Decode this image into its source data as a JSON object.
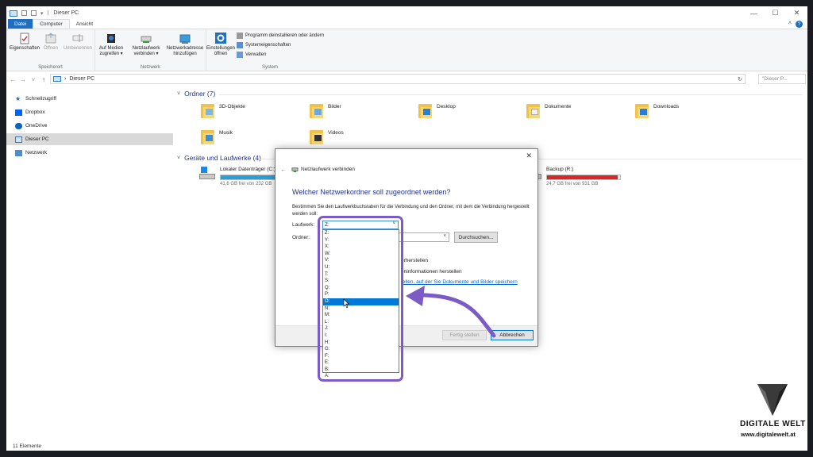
{
  "window": {
    "title": "Dieser PC",
    "controls": [
      "—",
      "☐",
      "✕"
    ]
  },
  "ribbon_tabs": [
    "Datei",
    "Computer",
    "Ansicht"
  ],
  "ribbon": {
    "groups": [
      {
        "label": "Speicherort",
        "buttons": [
          "Eigenschaften",
          "Öffnen",
          "Umbenennen"
        ]
      },
      {
        "label": "Netzwerk",
        "buttons": [
          "Auf Medien zugreifen ▾",
          "Netzlaufwerk verbinden ▾",
          "Netzwerkadresse hinzufügen"
        ]
      },
      {
        "label": "System",
        "buttons": [
          "Einstellungen öffnen"
        ],
        "small_buttons": [
          "Programm deinstallieren oder ändern",
          "Systemeigenschaften",
          "Verwalten"
        ]
      }
    ],
    "colors": {
      "file_tab": "#1e6fc2",
      "icon_blue": "#2f7bd0"
    }
  },
  "address": {
    "crumb": "Dieser PC",
    "search_placeholder": "\"Dieser P..."
  },
  "sidebar": {
    "items": [
      "Schnellzugriff",
      "Dropbox",
      "OneDrive",
      "Dieser PC",
      "Netzwerk"
    ],
    "selected": "Dieser PC"
  },
  "content": {
    "folders_header": "Ordner (7)",
    "folders": [
      "3D-Objekte",
      "Bilder",
      "Desktop",
      "Dokumente",
      "Downloads",
      "Musik",
      "Videos"
    ],
    "drives_header": "Geräte und Laufwerke (4)",
    "drives": [
      {
        "name": "Lokaler Datenträger (C:)",
        "free": "41,6 GB frei von 232 GB",
        "used_fraction": 0.82,
        "color": "#26a0da"
      },
      {
        "name": "Backup (R:)",
        "free": "24,7 GB frei von 931 GB",
        "used_fraction": 0.97,
        "color": "#da2626"
      }
    ]
  },
  "status_bar": {
    "items_count": "11 Elemente"
  },
  "dialog": {
    "title": "Netzlaufwerk verbinden",
    "heading": "Welcher Netzwerkordner soll zugeordnet werden?",
    "description": "Bestimmen Sie den Laufwerkbuchstaben für die Verbindung und den Ordner, mit dem die Verbindung hergestellt werden soll:",
    "drive_label": "Laufwerk:",
    "drive_value": "Z:",
    "folder_label": "Ordner:",
    "browse_button": "Durchsuchen...",
    "option_reconnect_partial": "erherstellen",
    "option_credentials_partial": "eninformationen herstellen",
    "link_partial": "tellen, auf der Sie Dokumente und Bilder speichern",
    "finish_button": "Fertig stellen",
    "cancel_button": "Abbrechen"
  },
  "drive_dropdown": {
    "options": [
      "Z:",
      "Y:",
      "X:",
      "W:",
      "V:",
      "U:",
      "T:",
      "S:",
      "Q:",
      "P:",
      "O:",
      "N:",
      "M:",
      "L:",
      "J:",
      "I:",
      "H:",
      "G:",
      "F:",
      "E:",
      "B:",
      "A:"
    ],
    "highlighted": "O:",
    "highlight_color": "#0078d7"
  },
  "annotation": {
    "color": "#7b5cc7"
  },
  "watermark": {
    "name": "DIGITALE WELT",
    "url": "www.digitalewelt.at"
  }
}
